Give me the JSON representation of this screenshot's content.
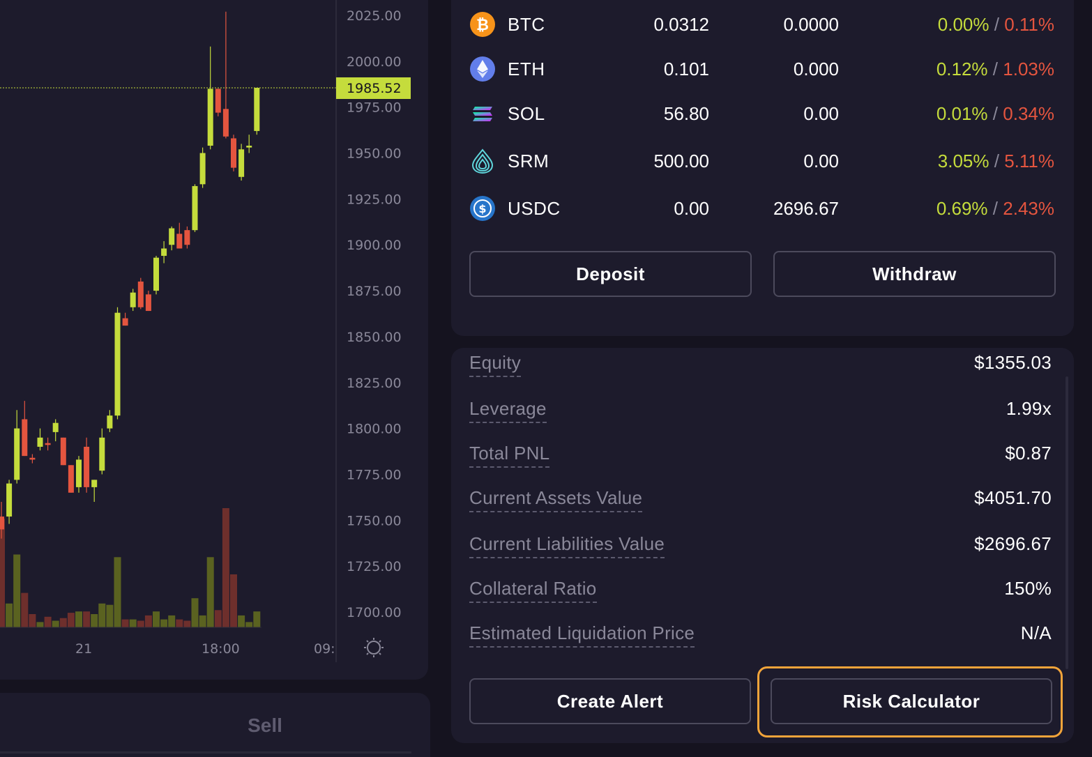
{
  "chart": {
    "price_ticks": [
      "2025.00",
      "2000.00",
      "1975.00",
      "1950.00",
      "1925.00",
      "1900.00",
      "1875.00",
      "1850.00",
      "1825.00",
      "1800.00",
      "1775.00",
      "1750.00",
      "1725.00",
      "1700.00"
    ],
    "current_price": "1985.52",
    "time_ticks": [
      "21",
      "18:00",
      "09:"
    ],
    "colors": {
      "up": "#c5dc3c",
      "down": "#e4553f",
      "up_volume": "#5a6220",
      "down_volume": "#6e2f2c",
      "price_line": "#c5dc3c"
    },
    "settings_icon": "sun-gear-icon"
  },
  "chart_data": {
    "type": "candlestick",
    "ylim": [
      1690,
      2030
    ],
    "y_ticks": [
      2025,
      2000,
      1975,
      1950,
      1925,
      1900,
      1875,
      1850,
      1825,
      1800,
      1775,
      1750,
      1725,
      1700
    ],
    "current_price": 1985.52,
    "x_ticks": [
      "21",
      "18:00",
      "09:"
    ],
    "candles": [
      {
        "o": 1752,
        "h": 1760,
        "l": 1740,
        "c": 1745
      },
      {
        "o": 1752,
        "h": 1772,
        "l": 1748,
        "c": 1770
      },
      {
        "o": 1772,
        "h": 1810,
        "l": 1770,
        "c": 1800
      },
      {
        "o": 1805,
        "h": 1815,
        "l": 1785,
        "c": 1785
      },
      {
        "o": 1784,
        "h": 1786,
        "l": 1781,
        "c": 1783
      },
      {
        "o": 1790,
        "h": 1800,
        "l": 1788,
        "c": 1795
      },
      {
        "o": 1792,
        "h": 1795,
        "l": 1788,
        "c": 1791
      },
      {
        "o": 1798,
        "h": 1805,
        "l": 1793,
        "c": 1803
      },
      {
        "o": 1795,
        "h": 1795,
        "l": 1780,
        "c": 1780
      },
      {
        "o": 1780,
        "h": 1780,
        "l": 1765,
        "c": 1765
      },
      {
        "o": 1768,
        "h": 1785,
        "l": 1765,
        "c": 1783
      },
      {
        "o": 1790,
        "h": 1795,
        "l": 1765,
        "c": 1768
      },
      {
        "o": 1768,
        "h": 1772,
        "l": 1760,
        "c": 1772
      },
      {
        "o": 1777,
        "h": 1800,
        "l": 1775,
        "c": 1795
      },
      {
        "o": 1800,
        "h": 1810,
        "l": 1798,
        "c": 1807
      },
      {
        "o": 1807,
        "h": 1866,
        "l": 1805,
        "c": 1863
      },
      {
        "o": 1860,
        "h": 1863,
        "l": 1856,
        "c": 1856
      },
      {
        "o": 1866,
        "h": 1876,
        "l": 1864,
        "c": 1874
      },
      {
        "o": 1880,
        "h": 1882,
        "l": 1865,
        "c": 1866
      },
      {
        "o": 1873,
        "h": 1875,
        "l": 1864,
        "c": 1864
      },
      {
        "o": 1875,
        "h": 1894,
        "l": 1873,
        "c": 1893
      },
      {
        "o": 1894,
        "h": 1902,
        "l": 1890,
        "c": 1898
      },
      {
        "o": 1900,
        "h": 1910,
        "l": 1897,
        "c": 1909
      },
      {
        "o": 1906,
        "h": 1912,
        "l": 1898,
        "c": 1898
      },
      {
        "o": 1908,
        "h": 1910,
        "l": 1898,
        "c": 1900
      },
      {
        "o": 1908,
        "h": 1933,
        "l": 1907,
        "c": 1932
      },
      {
        "o": 1933,
        "h": 1953,
        "l": 1931,
        "c": 1950
      },
      {
        "o": 1954,
        "h": 2008,
        "l": 1952,
        "c": 1985
      },
      {
        "o": 1985,
        "h": 1985,
        "l": 1970,
        "c": 1972
      },
      {
        "o": 1974,
        "h": 2027,
        "l": 1958,
        "c": 1959
      },
      {
        "o": 1958,
        "h": 1960,
        "l": 1940,
        "c": 1942
      },
      {
        "o": 1937,
        "h": 1955,
        "l": 1935,
        "c": 1952
      },
      {
        "o": 1953,
        "h": 1960,
        "l": 1950,
        "c": 1954
      },
      {
        "o": 1962,
        "h": 1985.52,
        "l": 1960,
        "c": 1985.52
      }
    ],
    "volumes": [
      0.82,
      0.18,
      0.55,
      0.26,
      0.1,
      0.04,
      0.08,
      0.05,
      0.07,
      0.11,
      0.12,
      0.12,
      0.1,
      0.18,
      0.17,
      0.53,
      0.06,
      0.06,
      0.05,
      0.09,
      0.12,
      0.06,
      0.09,
      0.06,
      0.05,
      0.22,
      0.09,
      0.53,
      0.13,
      0.9,
      0.4,
      0.09,
      0.04,
      0.12
    ]
  },
  "balances": [
    {
      "symbol": "BTC",
      "balance": "0.0312",
      "borrowed": "0.0000",
      "deposit_rate": "0.00%",
      "sep": "/",
      "borrow_rate": "0.11%",
      "icon": "btc-icon",
      "color": "#f7931a"
    },
    {
      "symbol": "ETH",
      "balance": "0.101",
      "borrowed": "0.000",
      "deposit_rate": "0.12%",
      "sep": "/",
      "borrow_rate": "1.03%",
      "icon": "eth-icon",
      "color": "#627eea"
    },
    {
      "symbol": "SOL",
      "balance": "56.80",
      "borrowed": "0.00",
      "deposit_rate": "0.01%",
      "sep": "/",
      "borrow_rate": "0.34%",
      "icon": "sol-icon",
      "color": "#9945ff"
    },
    {
      "symbol": "SRM",
      "balance": "500.00",
      "borrowed": "0.00",
      "deposit_rate": "3.05%",
      "sep": "/",
      "borrow_rate": "5.11%",
      "icon": "srm-icon",
      "color": "#5fd6dc"
    },
    {
      "symbol": "USDC",
      "balance": "0.00",
      "borrowed": "2696.67",
      "deposit_rate": "0.69%",
      "sep": "/",
      "borrow_rate": "2.43%",
      "icon": "usdc-icon",
      "color": "#2775ca"
    }
  ],
  "actions": {
    "deposit": "Deposit",
    "withdraw": "Withdraw",
    "create_alert": "Create Alert",
    "risk_calculator": "Risk Calculator"
  },
  "account": {
    "stats": [
      {
        "label": "Equity",
        "value": "$1355.03"
      },
      {
        "label": "Leverage",
        "value": "1.99x"
      },
      {
        "label": "Total PNL",
        "value": "$0.87"
      },
      {
        "label": "Current Assets Value",
        "value": "$4051.70"
      },
      {
        "label": "Current Liabilities Value",
        "value": "$2696.67"
      },
      {
        "label": "Collateral Ratio",
        "value": "150%"
      },
      {
        "label": "Estimated Liquidation Price",
        "value": "N/A"
      }
    ]
  },
  "trade": {
    "sell_tab": "Sell"
  },
  "theme": {
    "background": "#15131f",
    "panel": "#1d1b2c",
    "highlight": "#f2a43a",
    "positive": "#c5dc3c",
    "negative": "#e4553f"
  }
}
